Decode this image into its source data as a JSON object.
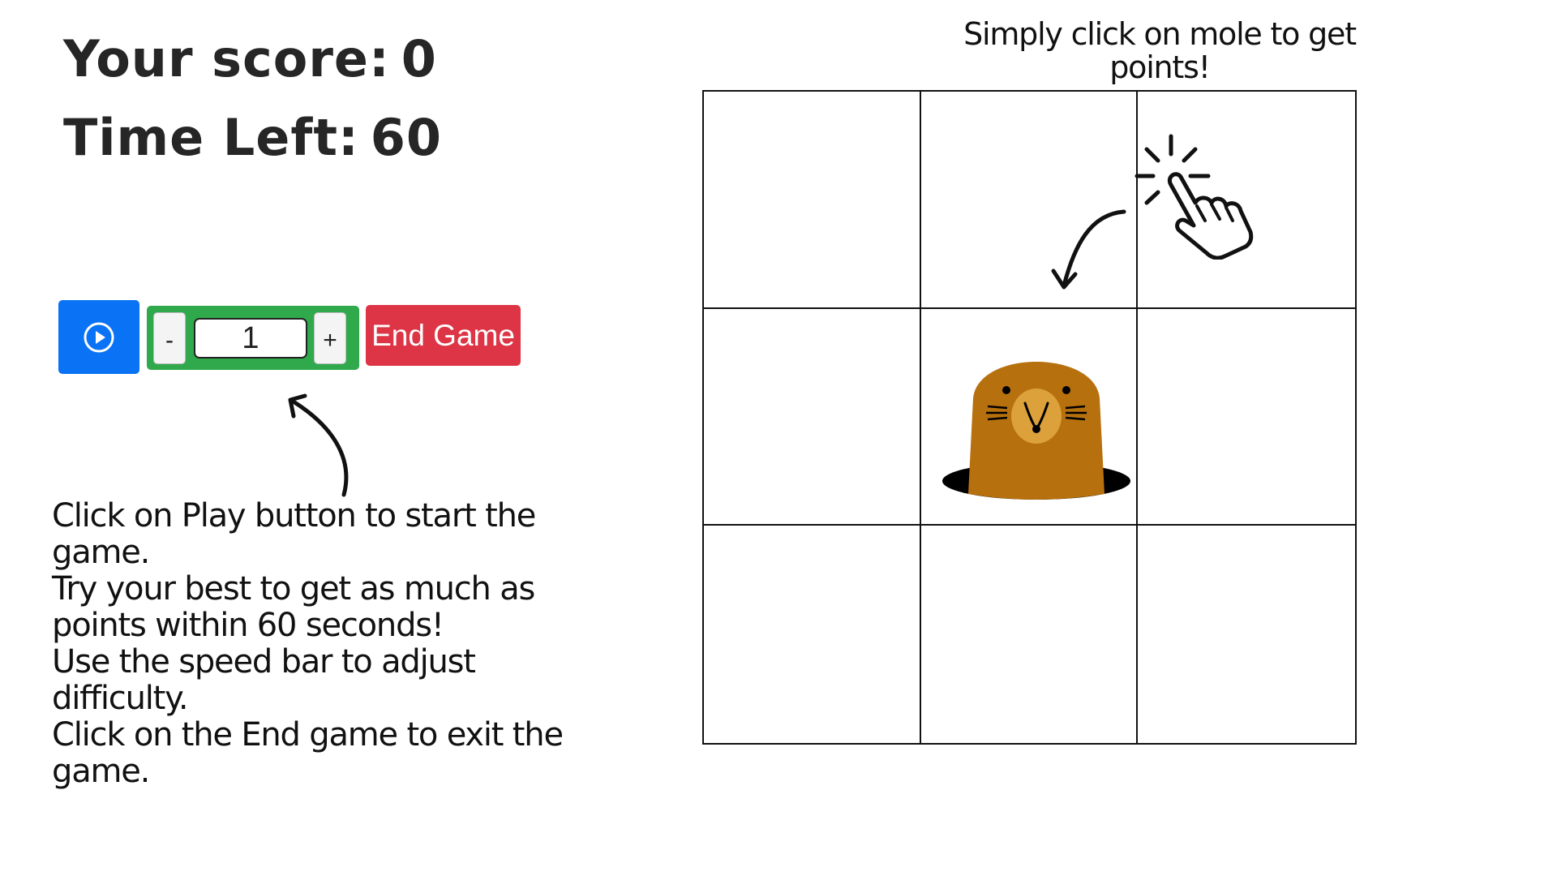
{
  "score": {
    "label": "Your score:",
    "value": "0"
  },
  "timer": {
    "label": "Time Left:",
    "value": "60"
  },
  "controls": {
    "play_icon": "play-circle-icon",
    "minus_label": "-",
    "plus_label": "+",
    "speed_value": "1",
    "end_label": "End Game"
  },
  "instructions": [
    "Click on Play button to start the game.",
    "Try your best to get as much as points within 60 seconds!",
    "Use the speed bar to adjust difficulty.",
    "Click on the End game to exit the game."
  ],
  "hint": "Simply click on mole to get points!",
  "board": {
    "holes": [
      "hole-1",
      "hole-2",
      "hole-3",
      "hole-4",
      "hole-5",
      "hole-6",
      "hole-7",
      "hole-8",
      "hole-9"
    ],
    "mole_hole": 5
  },
  "colors": {
    "play": "#0a73f5",
    "speed_bar": "#2fa94b",
    "end": "#dd3545",
    "mole_body": "#b7700e",
    "mole_snout": "#dca13a"
  },
  "icons": [
    "play-circle-icon",
    "pointer-click-icon",
    "curved-arrow-icon",
    "mole-icon"
  ]
}
